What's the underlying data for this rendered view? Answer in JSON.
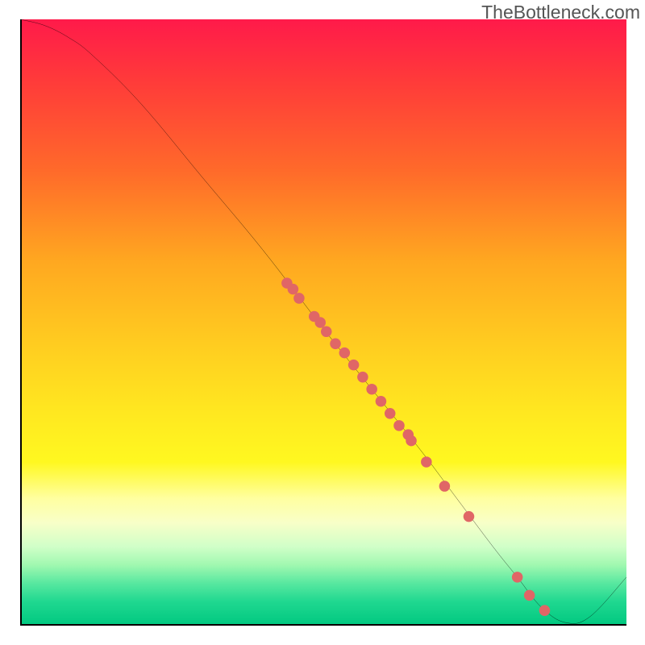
{
  "attribution": "TheBottleneck.com",
  "chart_data": {
    "type": "line",
    "title": "",
    "xlabel": "",
    "ylabel": "",
    "xlim": [
      0,
      100
    ],
    "ylim": [
      0,
      100
    ],
    "grid": false,
    "series": [
      {
        "name": "bottleneck-curve",
        "x": [
          0,
          4,
          8,
          12,
          20,
          30,
          40,
          50,
          58,
          66,
          72,
          78,
          82,
          86,
          90,
          94,
          100
        ],
        "y": [
          100,
          99,
          97,
          94,
          86,
          74,
          62,
          49,
          39,
          29,
          21,
          13,
          8,
          3,
          0.5,
          1.5,
          8
        ]
      }
    ],
    "scatter_points": {
      "name": "highlighted-points",
      "color": "#e06666",
      "points": [
        {
          "x": 44,
          "y": 56.5
        },
        {
          "x": 45,
          "y": 55.5
        },
        {
          "x": 46,
          "y": 54
        },
        {
          "x": 48.5,
          "y": 51
        },
        {
          "x": 49.5,
          "y": 50
        },
        {
          "x": 50.5,
          "y": 48.5
        },
        {
          "x": 52,
          "y": 46.5
        },
        {
          "x": 53.5,
          "y": 45
        },
        {
          "x": 55,
          "y": 43
        },
        {
          "x": 56.5,
          "y": 41
        },
        {
          "x": 58,
          "y": 39
        },
        {
          "x": 59.5,
          "y": 37
        },
        {
          "x": 61,
          "y": 35
        },
        {
          "x": 62.5,
          "y": 33
        },
        {
          "x": 64,
          "y": 31.5
        },
        {
          "x": 64.5,
          "y": 30.5
        },
        {
          "x": 67,
          "y": 27
        },
        {
          "x": 70,
          "y": 23
        },
        {
          "x": 74,
          "y": 18
        },
        {
          "x": 82,
          "y": 8
        },
        {
          "x": 84,
          "y": 5
        },
        {
          "x": 86.5,
          "y": 2.5
        }
      ]
    }
  }
}
